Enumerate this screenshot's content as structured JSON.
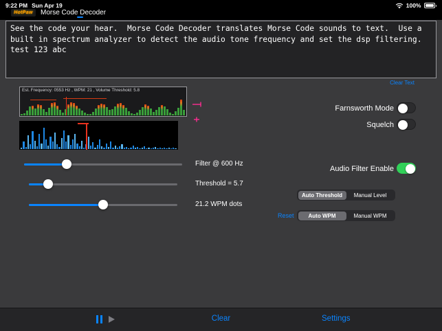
{
  "status_bar": {
    "time": "9:22 PM",
    "date": "Sun Apr 19",
    "battery": "100%"
  },
  "title_bar": {
    "logo_text": "HotPaw",
    "app_title": "Morse Code Decoder"
  },
  "decoder": {
    "text": "See the code your hear.  Morse Code Decoder translates Morse Code sounds to text.  Use a\nbuilt in spectrum analyzer to detect the audio tone frequency and set the dsp filtering.\ntest 123 abc",
    "clear_text_label": "Clear Text"
  },
  "analyzer": {
    "info": "Est. Frequency: 0553 Hz ,  WPM: 21 ,  Volume Threshold:  5.8",
    "spectrum_bars": [
      6,
      10,
      26,
      48,
      52,
      38,
      60,
      56,
      34,
      18,
      42,
      66,
      70,
      52,
      30,
      14,
      34,
      58,
      72,
      66,
      52,
      38,
      26,
      16,
      8,
      6,
      18,
      38,
      56,
      64,
      58,
      46,
      28,
      34,
      50,
      62,
      68,
      56,
      40,
      22,
      10,
      6,
      14,
      28,
      46,
      60,
      52,
      36,
      20,
      28,
      44,
      56,
      48,
      32,
      16,
      8,
      24,
      40,
      86,
      28
    ],
    "histogram_bars": [
      4,
      28,
      8,
      52,
      18,
      68,
      32,
      10,
      58,
      22,
      82,
      38,
      14,
      48,
      28,
      62,
      18,
      8,
      42,
      72,
      28,
      52,
      16,
      38,
      58,
      22,
      10,
      32,
      6,
      18,
      48,
      14,
      26,
      6,
      16,
      38,
      10,
      5,
      20,
      8,
      28,
      6,
      14,
      4,
      10,
      18,
      5,
      8,
      3,
      6,
      12,
      4,
      8,
      3,
      5,
      10,
      3,
      6,
      2,
      4,
      8,
      3,
      5,
      2,
      6,
      3,
      4,
      2,
      5,
      3
    ]
  },
  "sliders": [
    {
      "label": "Filter @  600 Hz",
      "value_pct": 27
    },
    {
      "label": "Threshold =  5.7",
      "value_pct": 13
    },
    {
      "label": "21.2 WPM dots",
      "value_pct": 50
    }
  ],
  "toggles": [
    {
      "label": "Farnsworth Mode",
      "on": false
    },
    {
      "label": "Squelch",
      "on": false
    },
    {
      "label": "Audio Filter Enable",
      "on": true
    }
  ],
  "segments": {
    "threshold": {
      "options": [
        "Auto Threshold",
        "Manual Level"
      ],
      "selected": 0
    },
    "wpm": {
      "options": [
        "Auto WPM",
        "Manual WPM"
      ],
      "selected": 0
    },
    "reset_label": "Reset"
  },
  "toolbar": {
    "clear_label": "Clear",
    "settings_label": "Settings"
  },
  "colors": {
    "accent_blue": "#0a84ff",
    "toggle_on_green": "#30d158",
    "spectrum_green": "#3a9e3a",
    "spectrum_orange": "#e0761f",
    "spectrum_red": "#d63a12",
    "histogram_blue": "#1e88e5",
    "histogram_light_blue": "#5ab6f0",
    "marker_magenta": "#ff2d92",
    "cursor_red": "#e8321e"
  }
}
